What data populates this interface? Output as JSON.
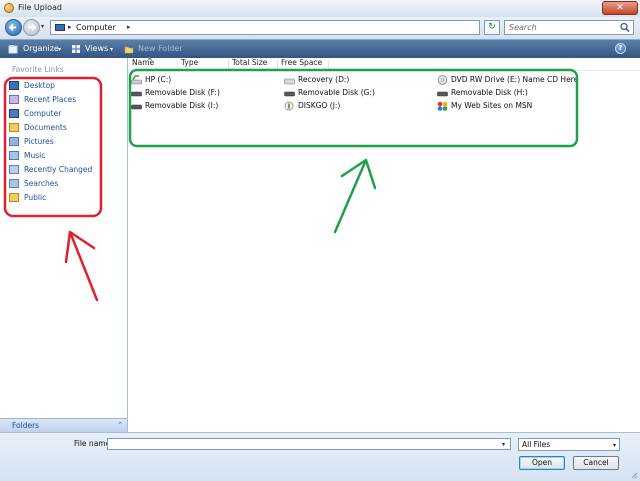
{
  "window": {
    "title": "File Upload",
    "close_glyph": "✕"
  },
  "address_bar": {
    "breadcrumb": "Computer",
    "separator_glyph": "▸",
    "dropdown_glyph": "▾",
    "refresh_glyph": "↻",
    "search_placeholder": "Search"
  },
  "toolbar": {
    "organize_label": "Organize",
    "views_label": "Views",
    "new_folder_label": "New Folder",
    "dropdown_glyph": "▾",
    "help_glyph": "?"
  },
  "nav_pane": {
    "heading": "Favorite Links",
    "items": [
      {
        "label": "Desktop",
        "icon": "desktop-icon"
      },
      {
        "label": "Recent Places",
        "icon": "recent-places-icon"
      },
      {
        "label": "Computer",
        "icon": "computer-icon"
      },
      {
        "label": "Documents",
        "icon": "documents-icon"
      },
      {
        "label": "Pictures",
        "icon": "pictures-icon"
      },
      {
        "label": "Music",
        "icon": "music-icon"
      },
      {
        "label": "Recently Changed",
        "icon": "recently-changed-icon"
      },
      {
        "label": "Searches",
        "icon": "searches-icon"
      },
      {
        "label": "Public",
        "icon": "public-icon"
      }
    ],
    "folders_label": "Folders",
    "folders_chevron": "⌃"
  },
  "columns": {
    "name": "Name",
    "type": "Type",
    "total_size": "Total Size",
    "free_space": "Free Space",
    "sort_glyph": "▲"
  },
  "drives": [
    {
      "label": "HP (C:)",
      "icon": "hard-drive-icon"
    },
    {
      "label": "Recovery (D:)",
      "icon": "hard-drive-icon"
    },
    {
      "label": "DVD RW Drive (E:) Name CD Here",
      "icon": "dvd-drive-icon"
    },
    {
      "label": "Removable Disk (F:)",
      "icon": "removable-disk-icon"
    },
    {
      "label": "Removable Disk (G:)",
      "icon": "removable-disk-icon"
    },
    {
      "label": "Removable Disk (H:)",
      "icon": "removable-disk-icon"
    },
    {
      "label": "Removable Disk (I:)",
      "icon": "removable-disk-icon"
    },
    {
      "label": "DISKGO (J:)",
      "icon": "usb-drive-icon"
    },
    {
      "label": "My Web Sites on MSN",
      "icon": "msn-icon"
    }
  ],
  "bottom": {
    "file_name_label": "File name:",
    "file_name_value": "",
    "filter_value": "All Files",
    "dropdown_glyph": "▾",
    "open_label": "Open",
    "cancel_label": "Cancel"
  },
  "colors": {
    "annotation_red": "#e0202a",
    "annotation_green": "#1fa04a",
    "link_blue": "#1b4f9c",
    "toolbar_blue": "#3a5e8c"
  }
}
